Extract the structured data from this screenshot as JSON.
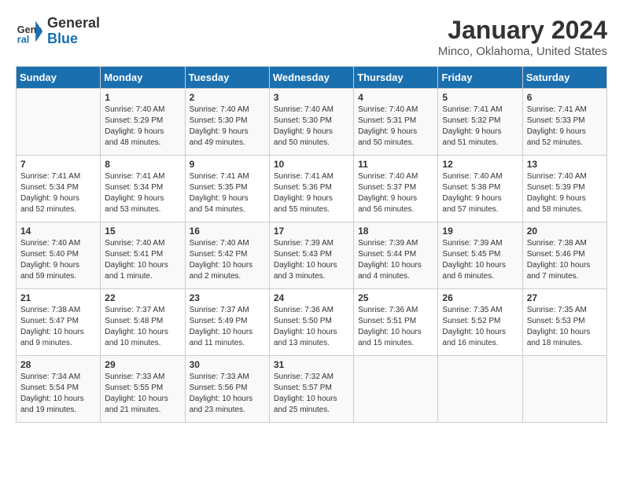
{
  "header": {
    "logo_line1": "General",
    "logo_line2": "Blue",
    "title": "January 2024",
    "subtitle": "Minco, Oklahoma, United States"
  },
  "calendar": {
    "days_of_week": [
      "Sunday",
      "Monday",
      "Tuesday",
      "Wednesday",
      "Thursday",
      "Friday",
      "Saturday"
    ],
    "weeks": [
      [
        {
          "day": "",
          "info": ""
        },
        {
          "day": "1",
          "info": "Sunrise: 7:40 AM\nSunset: 5:29 PM\nDaylight: 9 hours\nand 48 minutes."
        },
        {
          "day": "2",
          "info": "Sunrise: 7:40 AM\nSunset: 5:30 PM\nDaylight: 9 hours\nand 49 minutes."
        },
        {
          "day": "3",
          "info": "Sunrise: 7:40 AM\nSunset: 5:30 PM\nDaylight: 9 hours\nand 50 minutes."
        },
        {
          "day": "4",
          "info": "Sunrise: 7:40 AM\nSunset: 5:31 PM\nDaylight: 9 hours\nand 50 minutes."
        },
        {
          "day": "5",
          "info": "Sunrise: 7:41 AM\nSunset: 5:32 PM\nDaylight: 9 hours\nand 51 minutes."
        },
        {
          "day": "6",
          "info": "Sunrise: 7:41 AM\nSunset: 5:33 PM\nDaylight: 9 hours\nand 52 minutes."
        }
      ],
      [
        {
          "day": "7",
          "info": "Sunrise: 7:41 AM\nSunset: 5:34 PM\nDaylight: 9 hours\nand 52 minutes."
        },
        {
          "day": "8",
          "info": "Sunrise: 7:41 AM\nSunset: 5:34 PM\nDaylight: 9 hours\nand 53 minutes."
        },
        {
          "day": "9",
          "info": "Sunrise: 7:41 AM\nSunset: 5:35 PM\nDaylight: 9 hours\nand 54 minutes."
        },
        {
          "day": "10",
          "info": "Sunrise: 7:41 AM\nSunset: 5:36 PM\nDaylight: 9 hours\nand 55 minutes."
        },
        {
          "day": "11",
          "info": "Sunrise: 7:40 AM\nSunset: 5:37 PM\nDaylight: 9 hours\nand 56 minutes."
        },
        {
          "day": "12",
          "info": "Sunrise: 7:40 AM\nSunset: 5:38 PM\nDaylight: 9 hours\nand 57 minutes."
        },
        {
          "day": "13",
          "info": "Sunrise: 7:40 AM\nSunset: 5:39 PM\nDaylight: 9 hours\nand 58 minutes."
        }
      ],
      [
        {
          "day": "14",
          "info": "Sunrise: 7:40 AM\nSunset: 5:40 PM\nDaylight: 9 hours\nand 59 minutes."
        },
        {
          "day": "15",
          "info": "Sunrise: 7:40 AM\nSunset: 5:41 PM\nDaylight: 10 hours\nand 1 minute."
        },
        {
          "day": "16",
          "info": "Sunrise: 7:40 AM\nSunset: 5:42 PM\nDaylight: 10 hours\nand 2 minutes."
        },
        {
          "day": "17",
          "info": "Sunrise: 7:39 AM\nSunset: 5:43 PM\nDaylight: 10 hours\nand 3 minutes."
        },
        {
          "day": "18",
          "info": "Sunrise: 7:39 AM\nSunset: 5:44 PM\nDaylight: 10 hours\nand 4 minutes."
        },
        {
          "day": "19",
          "info": "Sunrise: 7:39 AM\nSunset: 5:45 PM\nDaylight: 10 hours\nand 6 minutes."
        },
        {
          "day": "20",
          "info": "Sunrise: 7:38 AM\nSunset: 5:46 PM\nDaylight: 10 hours\nand 7 minutes."
        }
      ],
      [
        {
          "day": "21",
          "info": "Sunrise: 7:38 AM\nSunset: 5:47 PM\nDaylight: 10 hours\nand 9 minutes."
        },
        {
          "day": "22",
          "info": "Sunrise: 7:37 AM\nSunset: 5:48 PM\nDaylight: 10 hours\nand 10 minutes."
        },
        {
          "day": "23",
          "info": "Sunrise: 7:37 AM\nSunset: 5:49 PM\nDaylight: 10 hours\nand 11 minutes."
        },
        {
          "day": "24",
          "info": "Sunrise: 7:36 AM\nSunset: 5:50 PM\nDaylight: 10 hours\nand 13 minutes."
        },
        {
          "day": "25",
          "info": "Sunrise: 7:36 AM\nSunset: 5:51 PM\nDaylight: 10 hours\nand 15 minutes."
        },
        {
          "day": "26",
          "info": "Sunrise: 7:35 AM\nSunset: 5:52 PM\nDaylight: 10 hours\nand 16 minutes."
        },
        {
          "day": "27",
          "info": "Sunrise: 7:35 AM\nSunset: 5:53 PM\nDaylight: 10 hours\nand 18 minutes."
        }
      ],
      [
        {
          "day": "28",
          "info": "Sunrise: 7:34 AM\nSunset: 5:54 PM\nDaylight: 10 hours\nand 19 minutes."
        },
        {
          "day": "29",
          "info": "Sunrise: 7:33 AM\nSunset: 5:55 PM\nDaylight: 10 hours\nand 21 minutes."
        },
        {
          "day": "30",
          "info": "Sunrise: 7:33 AM\nSunset: 5:56 PM\nDaylight: 10 hours\nand 23 minutes."
        },
        {
          "day": "31",
          "info": "Sunrise: 7:32 AM\nSunset: 5:57 PM\nDaylight: 10 hours\nand 25 minutes."
        },
        {
          "day": "",
          "info": ""
        },
        {
          "day": "",
          "info": ""
        },
        {
          "day": "",
          "info": ""
        }
      ]
    ]
  }
}
